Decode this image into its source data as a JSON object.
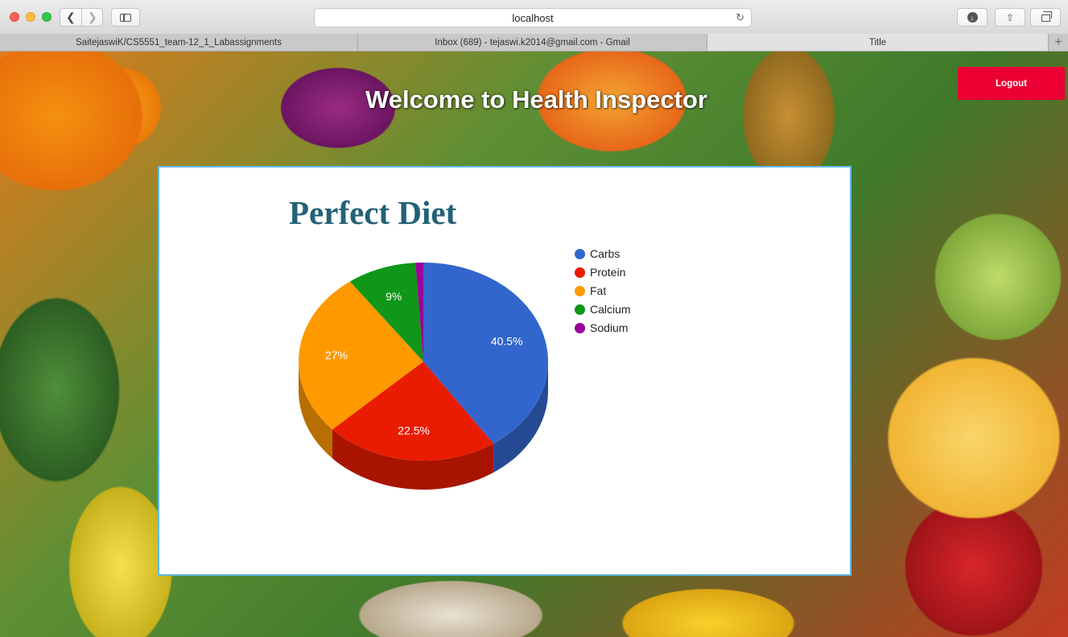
{
  "browser": {
    "address": "localhost",
    "tabs": [
      {
        "label": "SaitejaswiK/CS5551_team-12_1_Labassignments"
      },
      {
        "label": "Inbox (689) - tejaswi.k2014@gmail.com - Gmail"
      },
      {
        "label": "Title"
      }
    ]
  },
  "page": {
    "heading": "Welcome to Health Inspector",
    "logout_label": "Logout"
  },
  "chart_data": {
    "type": "pie",
    "title": "Perfect Diet",
    "style": "3d",
    "legend_position": "right",
    "categories": [
      "Carbs",
      "Protein",
      "Fat",
      "Calcium",
      "Sodium"
    ],
    "values": [
      40.5,
      22.5,
      27,
      9,
      1
    ],
    "labels": [
      "40.5%",
      "22.5%",
      "27%",
      "9%",
      ""
    ],
    "colors": [
      "#3366cc",
      "#ea1c00",
      "#ff9900",
      "#109618",
      "#990099"
    ]
  }
}
